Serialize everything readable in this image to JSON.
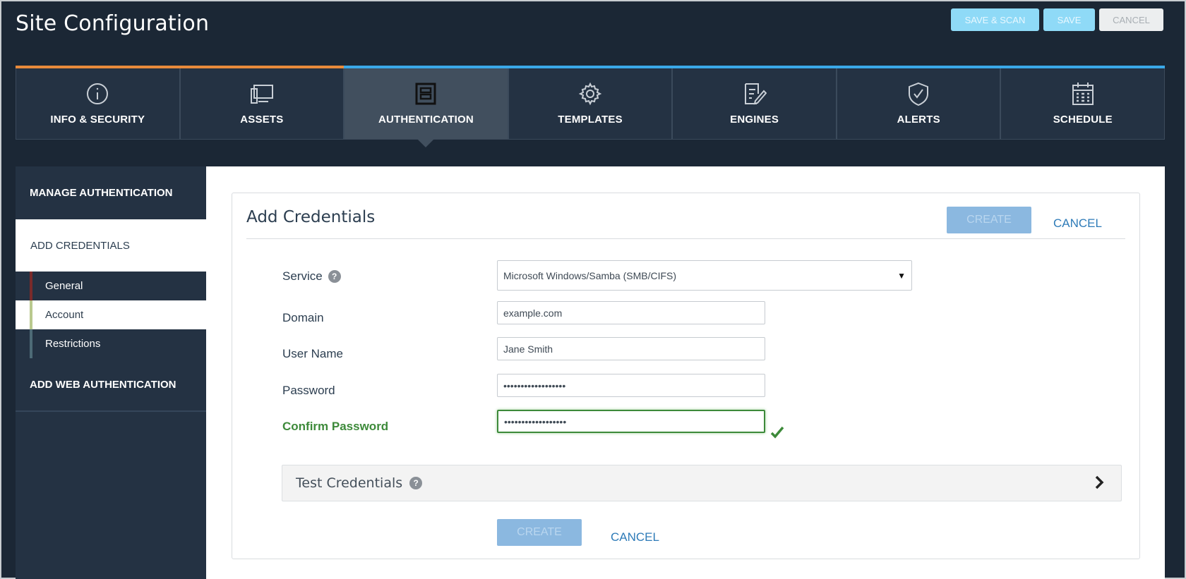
{
  "page": {
    "title": "Site Configuration",
    "actions": {
      "save_scan": "SAVE & SCAN",
      "save": "SAVE",
      "cancel": "CANCEL"
    }
  },
  "tabs": [
    {
      "label": "INFO & SECURITY",
      "icon": "info-icon",
      "bar_color": "#e88a3b"
    },
    {
      "label": "ASSETS",
      "icon": "assets-icon",
      "bar_color": "#e88a3b"
    },
    {
      "label": "AUTHENTICATION",
      "icon": "authentication-icon",
      "bar_color": "#3aa8e8",
      "active": true
    },
    {
      "label": "TEMPLATES",
      "icon": "gear-icon",
      "bar_color": "#3aa8e8"
    },
    {
      "label": "ENGINES",
      "icon": "engine-icon",
      "bar_color": "#3aa8e8"
    },
    {
      "label": "ALERTS",
      "icon": "shield-check-icon",
      "bar_color": "#3aa8e8"
    },
    {
      "label": "SCHEDULE",
      "icon": "calendar-icon",
      "bar_color": "#3aa8e8"
    }
  ],
  "sidebar": {
    "manage": "MANAGE AUTHENTICATION",
    "add_credentials": "ADD CREDENTIALS",
    "sub_items": [
      "General",
      "Account",
      "Restrictions"
    ],
    "add_web": "ADD WEB AUTHENTICATION"
  },
  "panel": {
    "title": "Add Credentials",
    "create_label": "CREATE",
    "cancel_label": "CANCEL",
    "fields": {
      "service": {
        "label": "Service",
        "value": "Microsoft Windows/Samba (SMB/CIFS)"
      },
      "domain": {
        "label": "Domain",
        "value": "example.com"
      },
      "username": {
        "label": "User Name",
        "value": "Jane Smith"
      },
      "password": {
        "label": "Password",
        "value": "••••••••••••••••••"
      },
      "confirm": {
        "label": "Confirm Password",
        "value": "••••••••••••••••••"
      }
    },
    "test_credentials": "Test Credentials",
    "help_glyph": "?"
  },
  "colors": {
    "accent": "#3aa8e8",
    "orange": "#e88a3b",
    "success": "#3d8a3a",
    "bg": "#1b2735"
  }
}
